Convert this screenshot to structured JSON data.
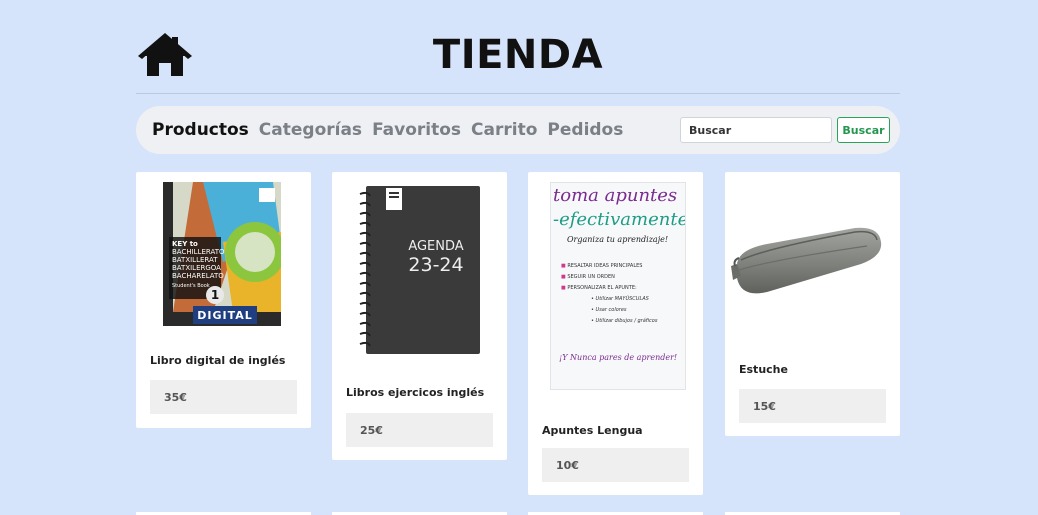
{
  "header": {
    "title": "TIENDA",
    "home_icon": "house-icon"
  },
  "nav": {
    "links": [
      "Productos",
      "Categorías",
      "Favoritos",
      "Carrito",
      "Pedidos"
    ],
    "active": "Productos",
    "search_placeholder": "Buscar",
    "search_button": "Buscar"
  },
  "products": [
    {
      "name": "Libro digital de inglés",
      "price": "35€",
      "cover": {
        "lines": [
          "KEY to",
          "BACHILLERATO",
          "BATXILLERAT",
          "BATXILERGOA",
          "BACHARELATO"
        ],
        "subtitle": "Student's Book",
        "number": "1",
        "band": "DIGITAL"
      }
    },
    {
      "name": "Libros ejercicos inglés",
      "price": "25€",
      "cover": {
        "line1": "AGENDA",
        "line2": "23-24"
      }
    },
    {
      "name": "Apuntes Lengua",
      "price": "10€",
      "cover": {
        "title1": "toma apuntes",
        "title2": "-efectivamente",
        "subtitle": "Organiza tu aprendizaje!",
        "items": [
          "RESALTAR IDEAS PRINCIPALES",
          "SEGUIR UN ORDEN",
          "PERSONALIZAR EL APUNTE:"
        ],
        "subitems": [
          "Utilizar MAYÚSCULAS",
          "Usar colores",
          "Utilizar dibujos / gráficos"
        ],
        "footer": "¡Y Nunca pares de aprender!"
      }
    },
    {
      "name": "Estuche",
      "price": "15€"
    }
  ],
  "colors": {
    "background": "#d6e4fb",
    "navbar": "#eef0f4",
    "search_button": "#23974f"
  }
}
